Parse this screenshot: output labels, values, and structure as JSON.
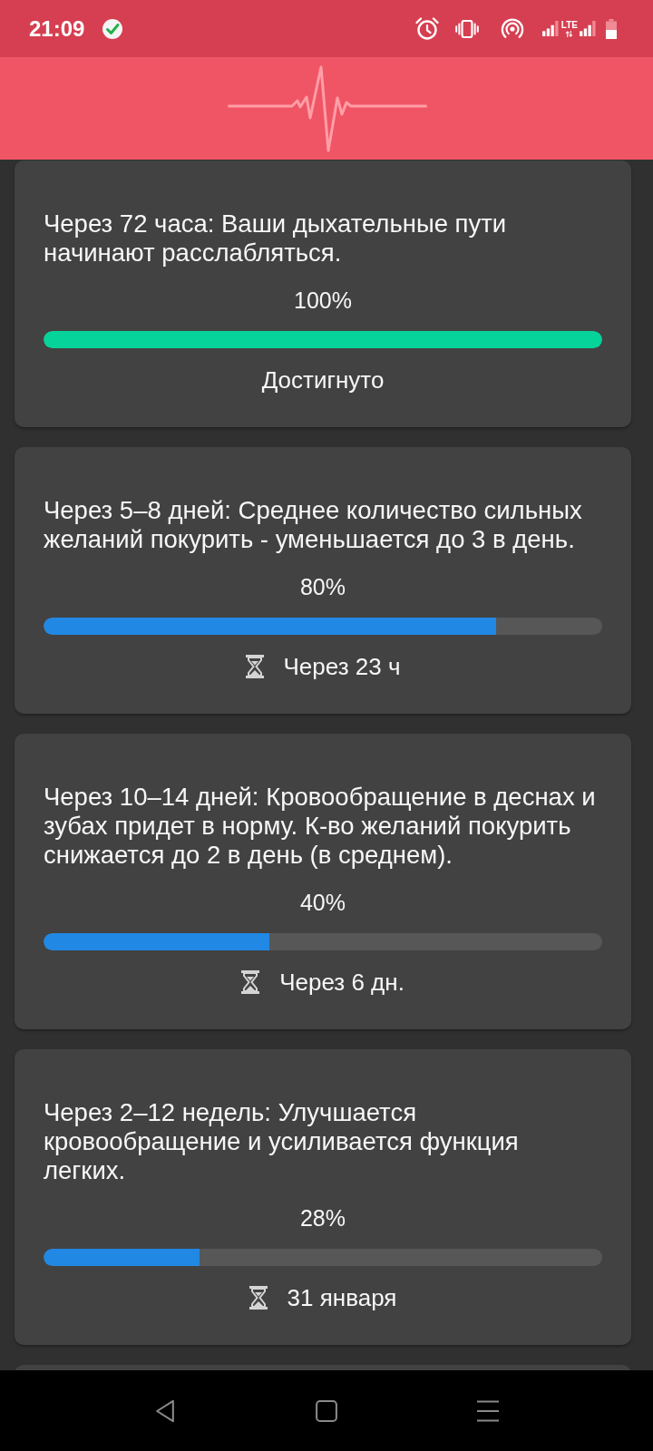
{
  "status_bar": {
    "time": "21:09",
    "network": "LTE"
  },
  "milestones": [
    {
      "text": "Через 72 часа: Ваши дыхательные пути начинают расслабляться.",
      "percent": "100%",
      "level": 1,
      "achieved": true,
      "status": "Достигнуто"
    },
    {
      "text": "Через 5–8 дней: Среднее количество сильных желаний покурить - уменьшается до 3 в день.",
      "percent": "80%",
      "level": 0.81,
      "achieved": false,
      "status": "Через 23 ч"
    },
    {
      "text": "Через 10–14 дней: Кровообращение в деснах и зубах придет в норму. К-во желаний покурить снижается до 2 в день (в среднем).",
      "percent": "40%",
      "level": 0.405,
      "achieved": false,
      "status": "Через 6 дн."
    },
    {
      "text": "Через 2–12 недель: Улучшается кровообращение и усиливается функция легких.",
      "percent": "28%",
      "level": 0.28,
      "achieved": false,
      "status": "31 января"
    }
  ]
}
